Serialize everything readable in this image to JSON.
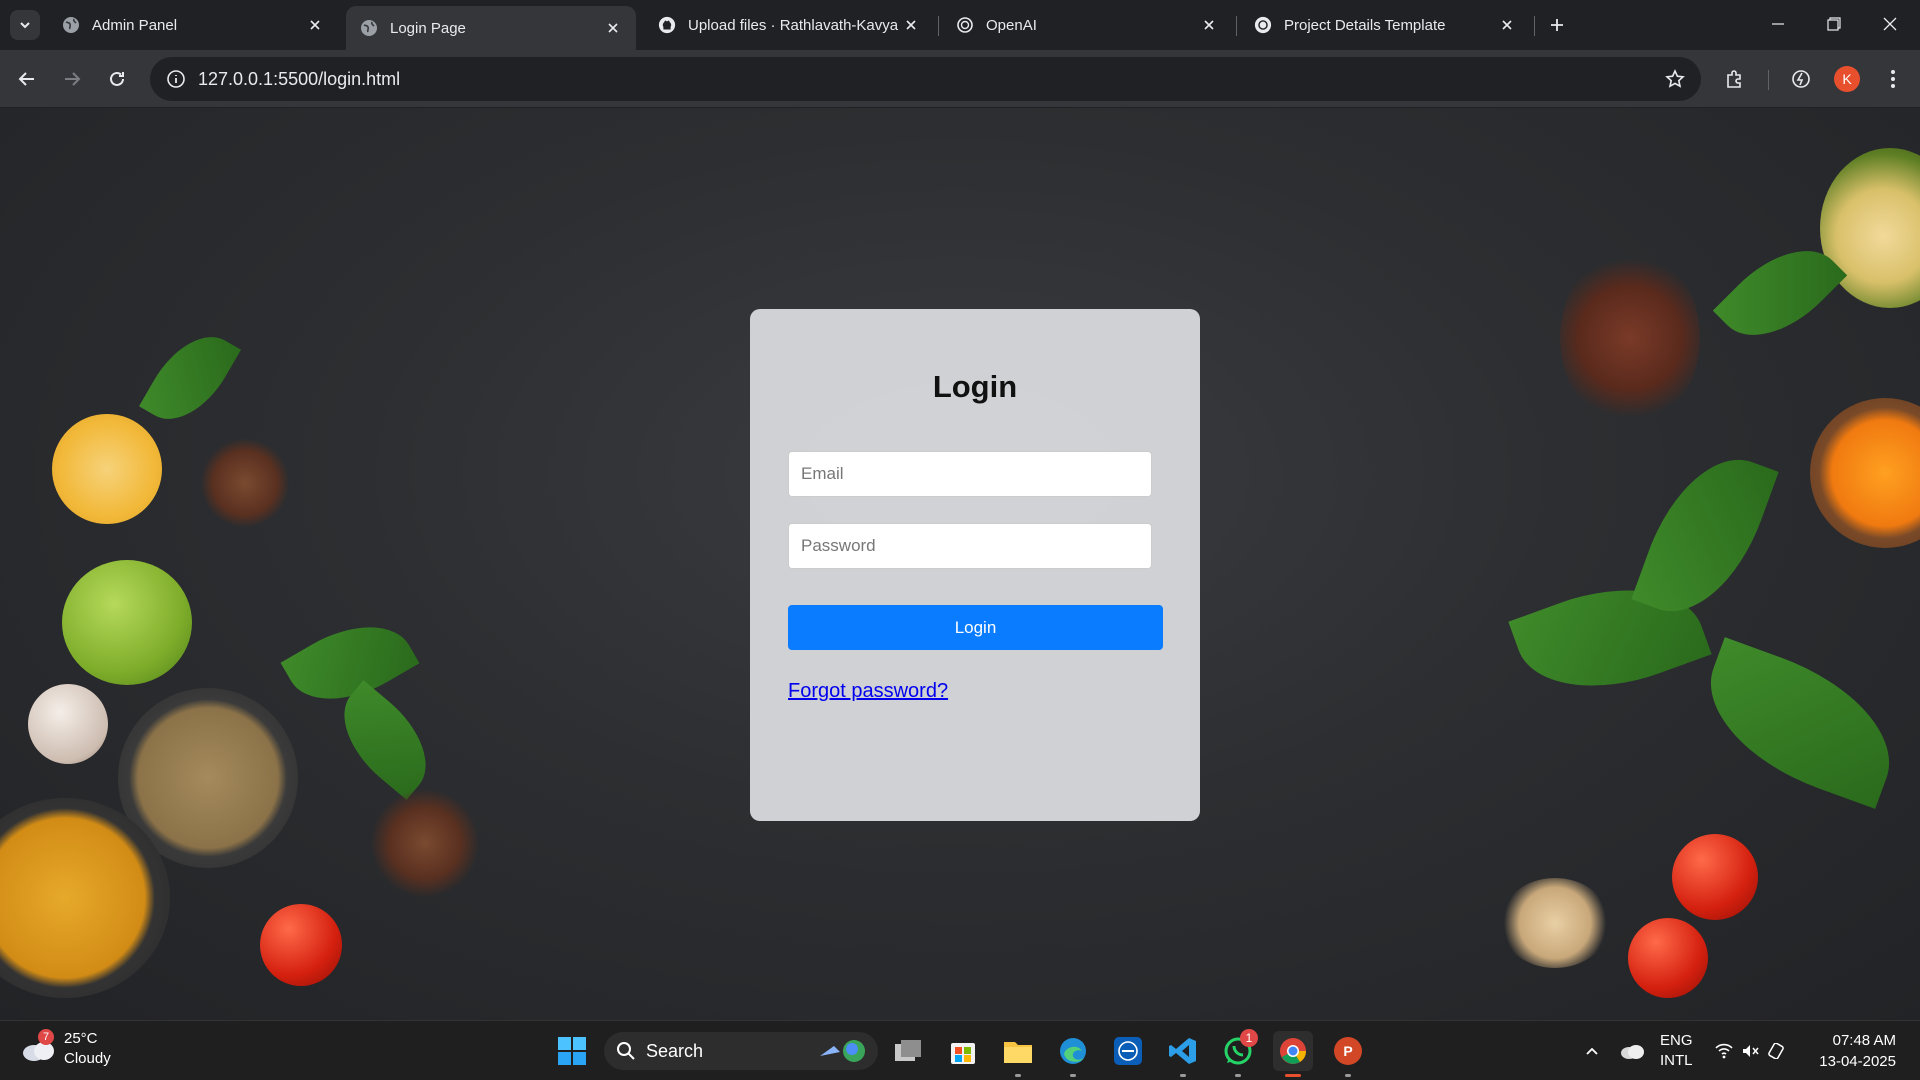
{
  "browser": {
    "tabs": [
      {
        "title": "Admin Panel",
        "icon": "globe-icon",
        "active": false
      },
      {
        "title": "Login Page",
        "icon": "globe-icon",
        "active": true
      },
      {
        "title": "Upload files · Rathlavath-Kavya",
        "icon": "github-icon",
        "active": false
      },
      {
        "title": "OpenAI",
        "icon": "openai-icon",
        "active": false
      },
      {
        "title": "Project Details Template",
        "icon": "openai-icon",
        "active": false
      }
    ],
    "url": "127.0.0.1:5500/login.html",
    "profile_initial": "K"
  },
  "login": {
    "title": "Login",
    "email_placeholder": "Email",
    "password_placeholder": "Password",
    "button_label": "Login",
    "forgot_link": "Forgot password?"
  },
  "taskbar": {
    "weather_temp": "25°C",
    "weather_desc": "Cloudy",
    "weather_badge": "7",
    "search_label": "Search",
    "whatsapp_badge": "1",
    "powerpoint_letter": "P",
    "lang_line1": "ENG",
    "lang_line2": "INTL",
    "time": "07:48 AM",
    "date": "13-04-2025"
  },
  "colors": {
    "accent_button": "#0a7cff",
    "link": "#0000ee",
    "card_bg": "#d6d7da",
    "browser_frame": "#202124",
    "toolbar": "#35363a",
    "profile_avatar": "#e8502d"
  }
}
